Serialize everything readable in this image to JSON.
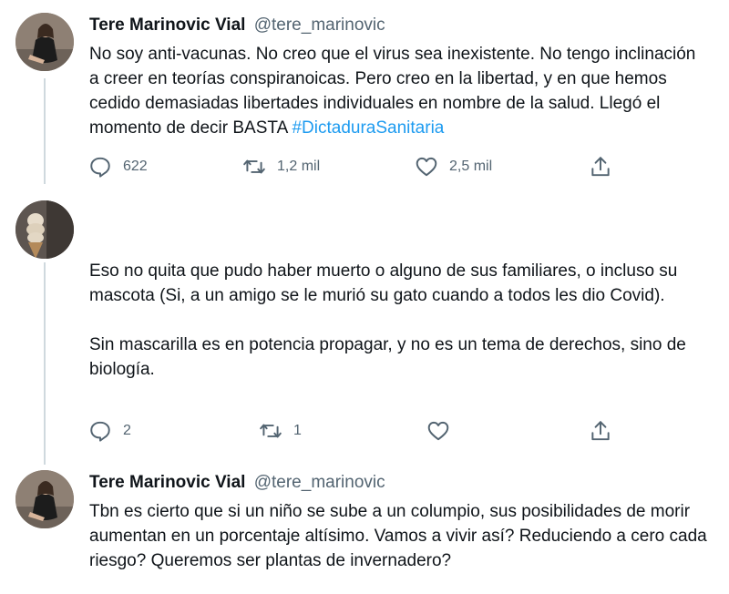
{
  "tweets": [
    {
      "display_name": "Tere Marinovic Vial",
      "handle": "@tere_marinovic",
      "text": "No soy anti-vacunas. No creo que el virus sea inexistente. No tengo inclinación a creer en teorías conspiranoicas. Pero creo en la libertad, y en que hemos cedido demasiadas libertades individuales en nombre de la salud. Llegó el momento de decir BASTA ",
      "hashtag": "#DictaduraSanitaria",
      "replies": "622",
      "retweets": "1,2 mil",
      "likes": "2,5 mil"
    },
    {
      "text": "Eso no quita que pudo haber muerto o alguno de sus familiares, o incluso su mascota (Si, a un amigo se le murió su gato cuando a todos les dio Covid).\n\nSin mascarilla es en potencia propagar, y no es un tema de derechos, sino de biología.",
      "replies": "2",
      "retweets": "1",
      "likes": ""
    },
    {
      "display_name": "Tere Marinovic Vial",
      "handle": "@tere_marinovic",
      "text": "Tbn es cierto que si un niño se sube a un columpio, sus posibilidades de morir aumentan en un porcentaje altísimo. Vamos a vivir así? Reduciendo a cero cada riesgo? Queremos ser plantas de invernadero?"
    }
  ],
  "icons": {
    "reply": "reply-icon",
    "retweet": "retweet-icon",
    "like": "like-icon",
    "share": "share-icon"
  },
  "colors": {
    "text": "#0f1419",
    "secondary": "#536471",
    "hashtag": "#1d9bf0",
    "thread_line": "#cfd9de"
  }
}
